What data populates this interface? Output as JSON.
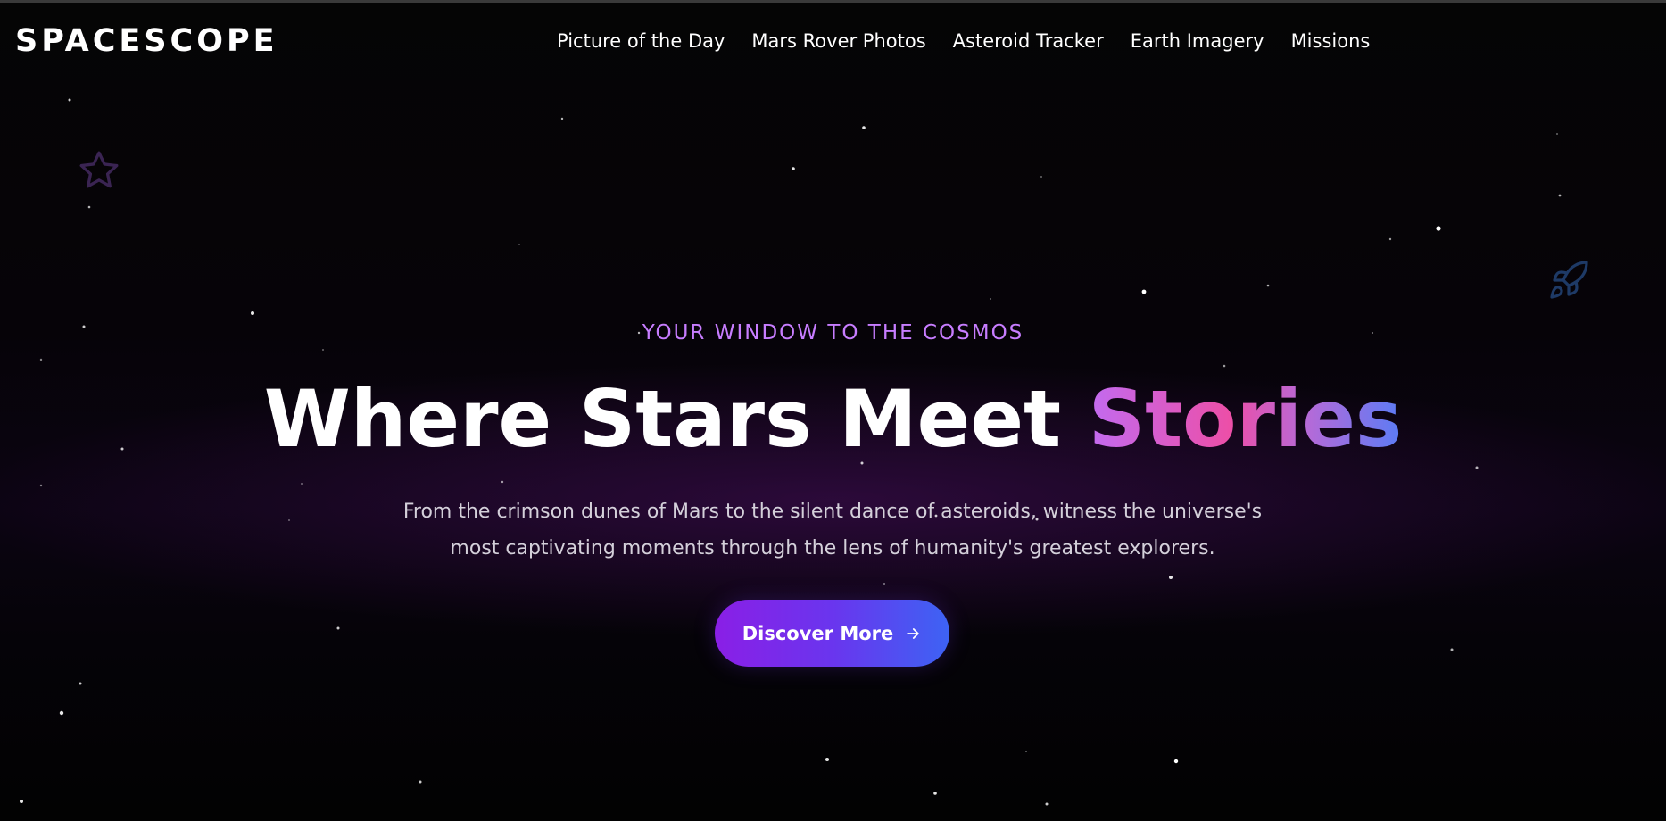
{
  "header": {
    "logo": "SPACESCOPE",
    "nav": [
      {
        "label": "Picture of the Day"
      },
      {
        "label": "Mars Rover Photos"
      },
      {
        "label": "Asteroid Tracker"
      },
      {
        "label": "Earth Imagery"
      },
      {
        "label": "Missions"
      }
    ]
  },
  "hero": {
    "tagline": "YOUR WINDOW TO THE COSMOS",
    "headline_main": "Where Stars Meet",
    "headline_accent": "Stories",
    "subtitle_line1": "From the crimson dunes of Mars to the silent dance of asteroids, witness the universe's",
    "subtitle_line2": "most captivating moments through the lens of humanity's greatest explorers.",
    "cta_label": "Discover More"
  },
  "icons": {
    "decor_left": "star-outline-icon",
    "decor_right": "rocket-icon",
    "cta": "arrow-right-icon"
  },
  "colors": {
    "accent_purple": "#c77dff",
    "cta_start": "#8a1fe6",
    "cta_end": "#3d63f4",
    "headline_accent_start": "#c26bf0",
    "headline_accent_mid": "#ec4fa8",
    "headline_accent_end": "#5b7cf5"
  }
}
